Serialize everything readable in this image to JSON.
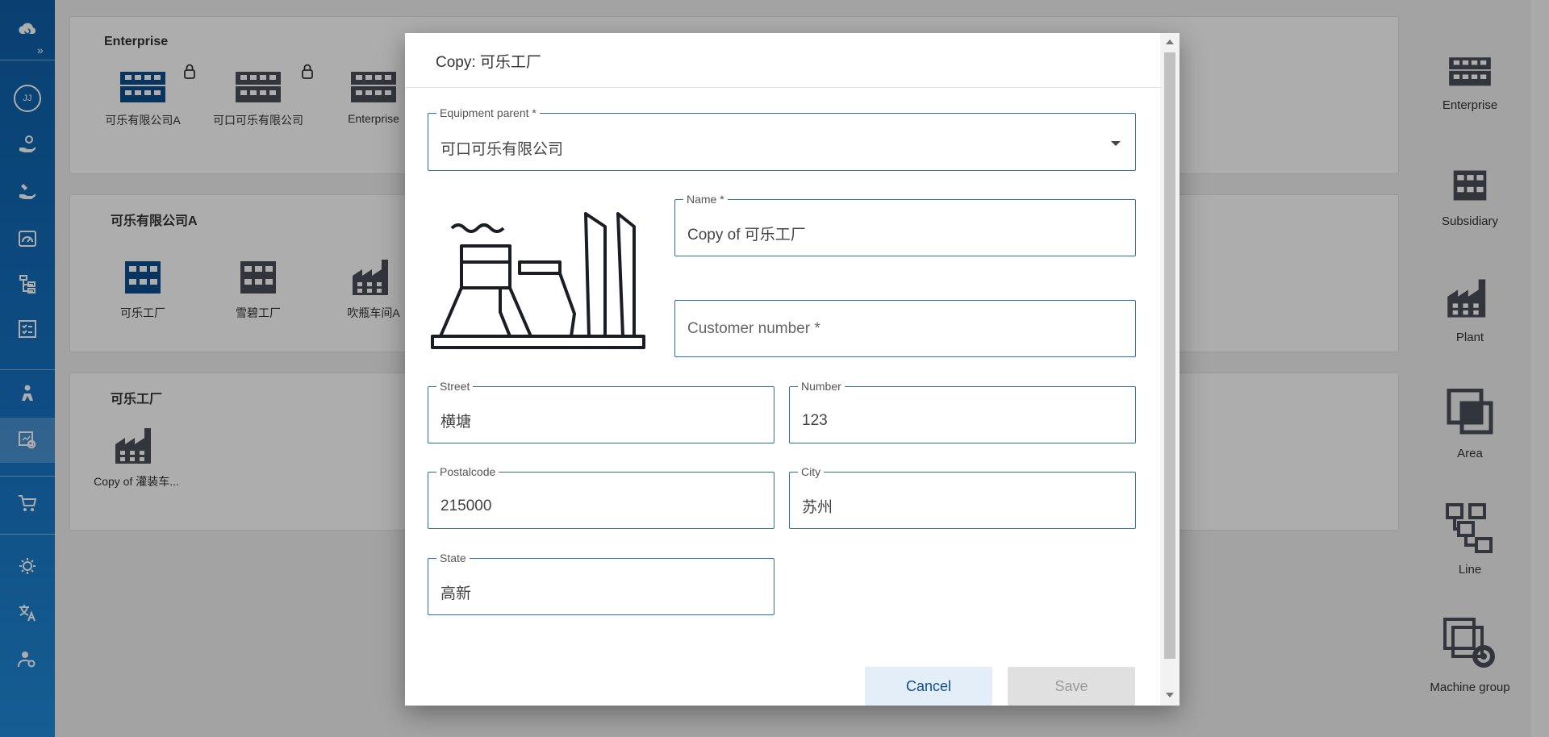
{
  "nav": {
    "brand_icon": "cloud-logo-icon",
    "avatar_initials": "JJ",
    "items": [
      "hand-coin-icon",
      "hand-tools-icon",
      "dashboard-gauge-icon",
      "hierarchy-list-icon",
      "checklist-icon",
      "worker-icon",
      "equipment-settings-icon",
      "cart-icon",
      "brightness-icon",
      "translate-icon",
      "user-settings-icon"
    ]
  },
  "panels": [
    {
      "title": "Enterprise",
      "tiles": [
        {
          "label": "可乐有限公司A",
          "locked": true,
          "color": "#0d4f8e"
        },
        {
          "label": "可口可乐有限公司",
          "locked": true,
          "color": "#4a4f57"
        },
        {
          "label": "Enterprise",
          "locked": true,
          "color": "#4a4f57"
        }
      ]
    },
    {
      "title": "可乐有限公司A",
      "tiles": [
        {
          "label": "可乐工厂",
          "color": "#0d4f8e"
        },
        {
          "label": "雪碧工厂",
          "color": "#4a4f57"
        },
        {
          "label": "吹瓶车间A",
          "color": "#4a4f57"
        }
      ]
    },
    {
      "title": "可乐工厂",
      "tiles": [
        {
          "label": "Copy of 灌装车...",
          "color": "#4a4f57"
        }
      ]
    }
  ],
  "right_panel": [
    {
      "label": "Enterprise",
      "icon": "enterprise-icon"
    },
    {
      "label": "Subsidiary",
      "icon": "subsidiary-icon"
    },
    {
      "label": "Plant",
      "icon": "plant-icon"
    },
    {
      "label": "Area",
      "icon": "area-icon"
    },
    {
      "label": "Line",
      "icon": "line-icon"
    },
    {
      "label": "Machine group",
      "icon": "machine-group-icon"
    }
  ],
  "dialog": {
    "title": "Copy: 可乐工厂",
    "equipment_parent": {
      "label": "Equipment parent *",
      "value": "可口可乐有限公司"
    },
    "name": {
      "label": "Name *",
      "value": "Copy of 可乐工厂"
    },
    "customer_number": {
      "placeholder": "Customer number *",
      "value": ""
    },
    "street": {
      "label": "Street",
      "value": "横塘"
    },
    "number": {
      "label": "Number",
      "value": "123"
    },
    "postalcode": {
      "label": "Postalcode",
      "value": "215000"
    },
    "city": {
      "label": "City",
      "value": "苏州"
    },
    "state": {
      "label": "State",
      "value": "高新"
    },
    "cancel_label": "Cancel",
    "save_label": "Save"
  },
  "colors": {
    "accent": "#2d6db3",
    "nav": "#1572c2",
    "primary_dark": "#0d4f8e"
  }
}
